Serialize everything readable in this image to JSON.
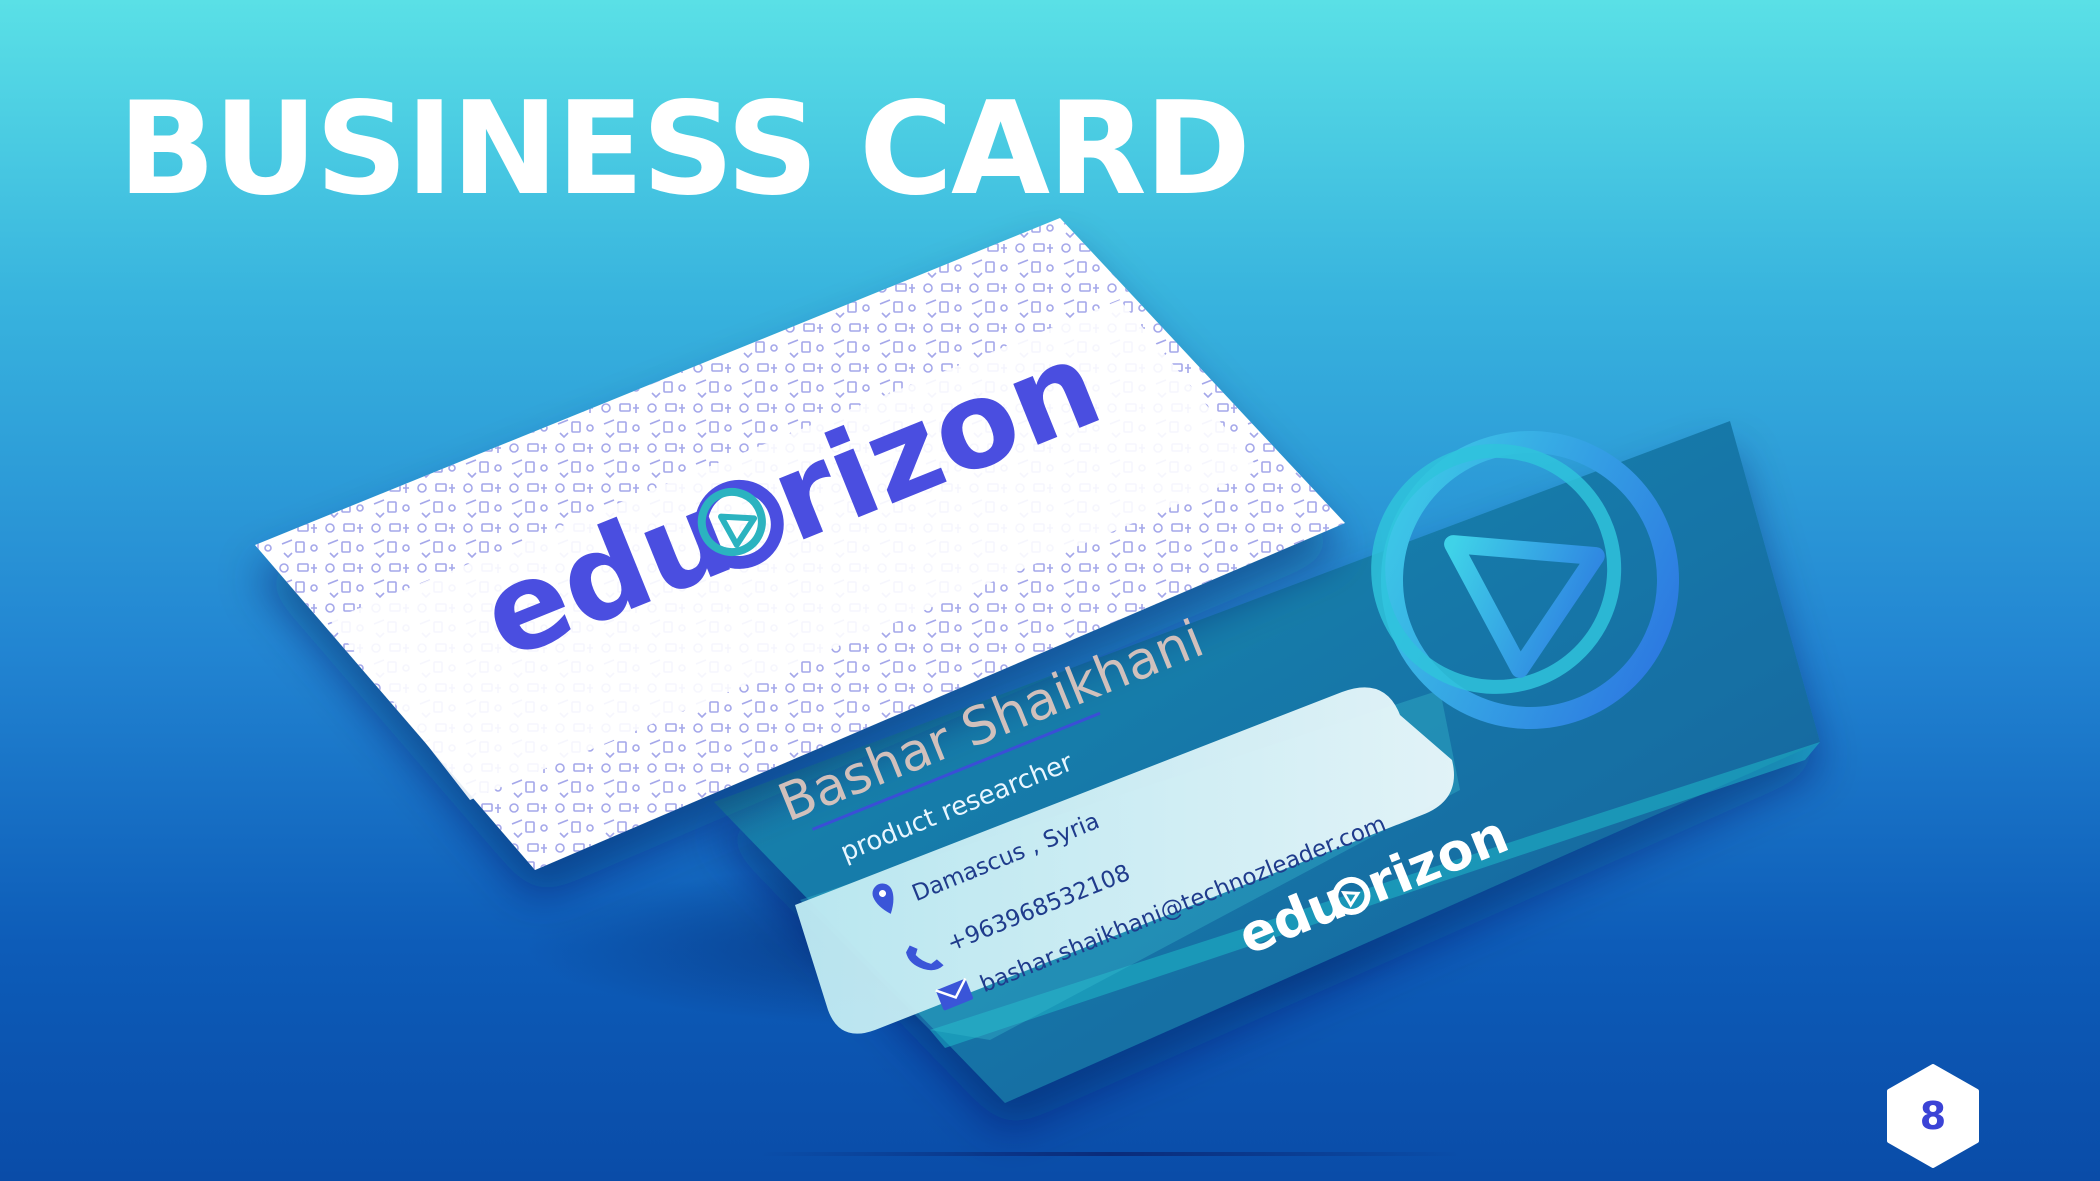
{
  "slide": {
    "title": "BUSINESS CARD",
    "page_number": "8"
  },
  "front_card": {
    "logo_text_left": "edu",
    "logo_text_right": "rizon",
    "logo_color": "#4a4ee0",
    "logo_ring_color": "#2bb3c0",
    "pattern_color": "#5a5fd8"
  },
  "back_card": {
    "name": "Bashar Shaikhani",
    "role": "product researcher",
    "location": "Damascus , Syria",
    "phone": "+963968532108",
    "email": "bashar.shaikhani@technozleader.com",
    "logo_text_left": "edu",
    "logo_text_right": "rizon",
    "icons": [
      "location-pin-icon",
      "phone-icon",
      "envelope-icon"
    ],
    "accent_color": "#4a5ee0"
  },
  "colors": {
    "background_top": "#5ae0e6",
    "background_bottom": "#0a4ca8",
    "badge_text": "#3b43d6"
  }
}
